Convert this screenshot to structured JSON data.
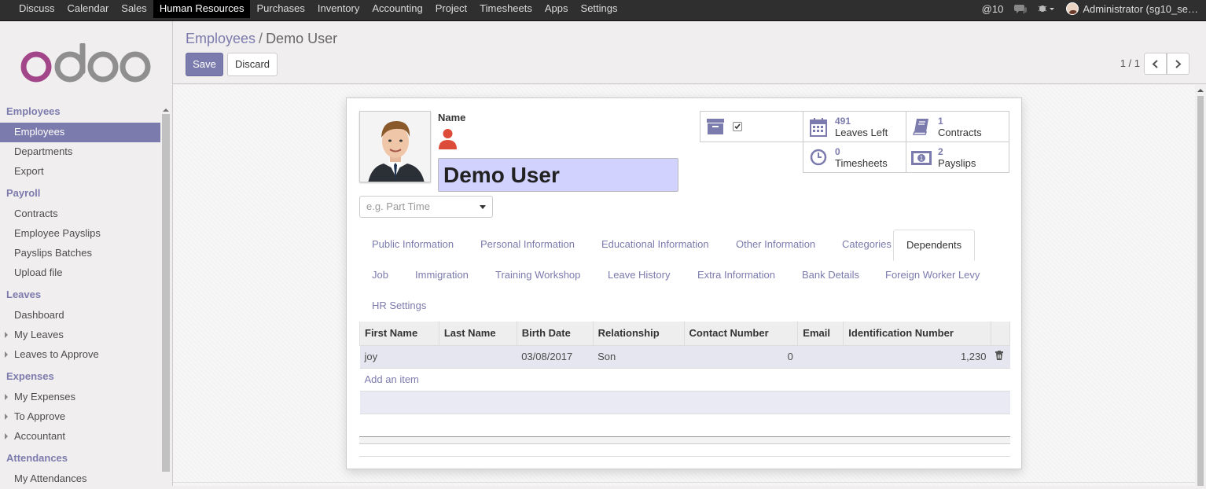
{
  "topbar": {
    "menu": [
      "Discuss",
      "Calendar",
      "Sales",
      "Human Resources",
      "Purchases",
      "Inventory",
      "Accounting",
      "Project",
      "Timesheets",
      "Apps",
      "Settings"
    ],
    "active_menu": "Human Resources",
    "mentions_count": "@10",
    "user": "Administrator (sg10_se…"
  },
  "sidebar": {
    "sections": [
      {
        "title": "Employees",
        "items": [
          {
            "label": "Employees",
            "active": true,
            "caret": false
          },
          {
            "label": "Departments",
            "active": false,
            "caret": false
          },
          {
            "label": "Export",
            "active": false,
            "caret": false
          }
        ]
      },
      {
        "title": "Payroll",
        "items": [
          {
            "label": "Contracts",
            "active": false,
            "caret": false
          },
          {
            "label": "Employee Payslips",
            "active": false,
            "caret": false
          },
          {
            "label": "Payslips Batches",
            "active": false,
            "caret": false
          },
          {
            "label": "Upload file",
            "active": false,
            "caret": false
          }
        ]
      },
      {
        "title": "Leaves",
        "items": [
          {
            "label": "Dashboard",
            "active": false,
            "caret": false
          },
          {
            "label": "My Leaves",
            "active": false,
            "caret": true
          },
          {
            "label": "Leaves to Approve",
            "active": false,
            "caret": true
          }
        ]
      },
      {
        "title": "Expenses",
        "items": [
          {
            "label": "My Expenses",
            "active": false,
            "caret": true
          },
          {
            "label": "To Approve",
            "active": false,
            "caret": true
          },
          {
            "label": "Accountant",
            "active": false,
            "caret": true
          }
        ]
      },
      {
        "title": "Attendances",
        "items": [
          {
            "label": "My Attendances",
            "active": false,
            "caret": false
          }
        ]
      }
    ]
  },
  "control_panel": {
    "breadcrumb_parent": "Employees",
    "breadcrumb_sep": "/",
    "breadcrumb_current": "Demo User",
    "save_label": "Save",
    "discard_label": "Discard",
    "pager": "1 / 1"
  },
  "form": {
    "name_label": "Name",
    "name_value": "Demo User",
    "category_placeholder": "e.g. Part Time",
    "smart_buttons": {
      "leaves_num": "491",
      "leaves_label": "Leaves Left",
      "contracts_num": "1",
      "contracts_label": "Contracts",
      "timesheets_num": "0",
      "timesheets_label": "Timesheets",
      "payslips_num": "2",
      "payslips_label": "Payslips"
    },
    "tabs_row1": [
      "Public Information",
      "Personal Information",
      "Educational Information",
      "Other Information",
      "Categories",
      "Dependents"
    ],
    "tabs_row2": [
      "Job",
      "Immigration",
      "Training Workshop",
      "Leave History",
      "Extra Information",
      "Bank Details",
      "Foreign Worker Levy"
    ],
    "tabs_row3": [
      "HR Settings"
    ],
    "active_tab": "Dependents",
    "dependents": {
      "columns": [
        "First Name",
        "Last Name",
        "Birth Date",
        "Relationship",
        "Contact Number",
        "Email",
        "Identification Number"
      ],
      "rows": [
        {
          "first_name": "joy",
          "last_name": "",
          "birth_date": "03/08/2017",
          "relationship": "Son",
          "contact_number": "0",
          "email": "",
          "identification_number": "1,230"
        }
      ],
      "add_item_label": "Add an item"
    }
  },
  "colors": {
    "accent": "#7c7bad",
    "topbar": "#2f2f2f",
    "name_bg": "#d2d2ff",
    "person_icon": "#dd4b39"
  }
}
